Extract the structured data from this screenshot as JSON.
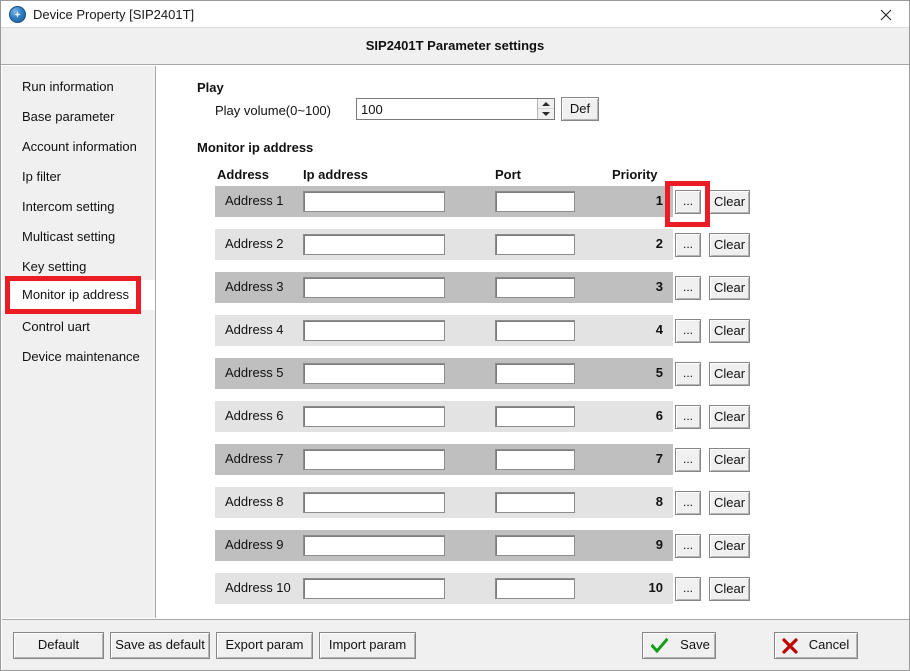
{
  "window": {
    "title": "Device Property [SIP2401T]",
    "app_icon": "device-globe-icon",
    "close_icon": "close-icon"
  },
  "header": {
    "title": "SIP2401T Parameter settings"
  },
  "sidebar": {
    "items": [
      {
        "label": "Run information",
        "selected": false
      },
      {
        "label": "Base parameter",
        "selected": false
      },
      {
        "label": "Account information",
        "selected": false
      },
      {
        "label": "Ip filter",
        "selected": false
      },
      {
        "label": "Intercom setting",
        "selected": false
      },
      {
        "label": "Multicast setting",
        "selected": false
      },
      {
        "label": "Key setting",
        "selected": false
      },
      {
        "label": "Monitor ip address",
        "selected": true
      },
      {
        "label": "Control uart",
        "selected": false
      },
      {
        "label": "Device maintenance",
        "selected": false
      }
    ]
  },
  "play": {
    "group_label": "Play",
    "volume_label": "Play volume(0~100)",
    "volume_value": "100",
    "def_button": "Def",
    "spin_up_icon": "caret-up-icon",
    "spin_down_icon": "caret-down-icon"
  },
  "monitor": {
    "group_label": "Monitor ip address",
    "columns": [
      "Address",
      "Ip address",
      "Port",
      "Priority"
    ],
    "browse_button": "...",
    "clear_button": "Clear",
    "rows": [
      {
        "address": "Address 1",
        "ip": "",
        "port": "",
        "priority": "1"
      },
      {
        "address": "Address 2",
        "ip": "",
        "port": "",
        "priority": "2"
      },
      {
        "address": "Address 3",
        "ip": "",
        "port": "",
        "priority": "3"
      },
      {
        "address": "Address 4",
        "ip": "",
        "port": "",
        "priority": "4"
      },
      {
        "address": "Address 5",
        "ip": "",
        "port": "",
        "priority": "5"
      },
      {
        "address": "Address 6",
        "ip": "",
        "port": "",
        "priority": "6"
      },
      {
        "address": "Address 7",
        "ip": "",
        "port": "",
        "priority": "7"
      },
      {
        "address": "Address 8",
        "ip": "",
        "port": "",
        "priority": "8"
      },
      {
        "address": "Address 9",
        "ip": "",
        "port": "",
        "priority": "9"
      },
      {
        "address": "Address 10",
        "ip": "",
        "port": "",
        "priority": "10"
      }
    ]
  },
  "footer": {
    "default_label": "Default",
    "save_as_default_label": "Save as default",
    "export_label": "Export param",
    "import_label": "Import param",
    "save_label": "Save",
    "cancel_label": "Cancel",
    "save_icon": "green-check-icon",
    "cancel_icon": "red-x-icon"
  },
  "annotations": {
    "accent_color": "#ec1c24",
    "highlighted_sidebar_item": "Monitor ip address",
    "highlighted_button": "... (Address 1 browse)"
  }
}
